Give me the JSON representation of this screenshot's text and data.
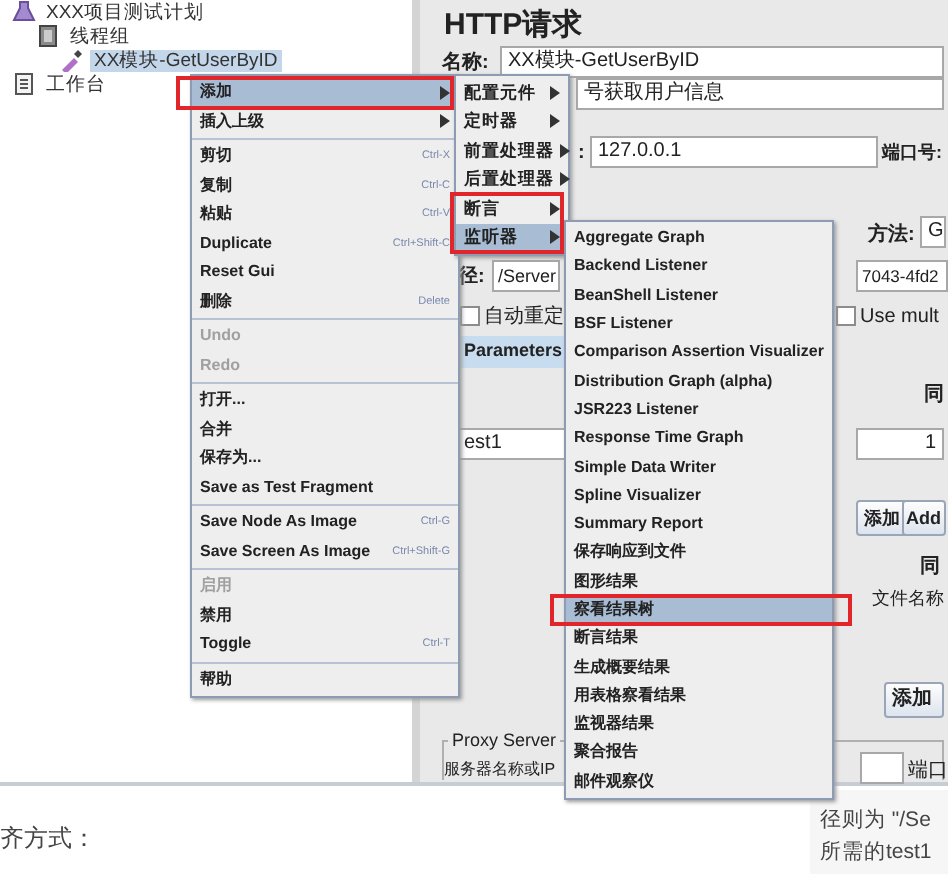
{
  "tree": [
    {
      "label": "XXX项目测试计划",
      "selected": false,
      "children": [
        {
          "label": "线程组",
          "selected": false,
          "children": [
            {
              "label": "XX模块-GetUserByID",
              "selected": true
            }
          ]
        }
      ]
    },
    {
      "label": "工作台",
      "selected": false
    }
  ],
  "http_panel": {
    "title": "HTTP请求",
    "name_label": "名称:",
    "name_value": "XX模块-GetUserByID",
    "comment_value": "号获取用户信息",
    "server_label": ":",
    "server_value": "127.0.0.1",
    "port_label": "端口号:",
    "method_label": "方法:",
    "method_value": "G",
    "path_label": "径:",
    "path_value": "/Server",
    "path_value_tail": "7043-4fd2",
    "redirect_label": "自动重定",
    "redirect_checked": false,
    "multipart_label": "Use mult",
    "multipart_checked": false,
    "tab": "Parameters",
    "header_1": "同",
    "cell_1": "est1",
    "cell_2": "1",
    "add_button": "添加",
    "add_button_2": "Add",
    "header_2": "同",
    "files_header": "文件名称",
    "add_button_3": "添加",
    "proxy_label": "Proxy Server",
    "proxy_host_label": "服务器名称或IP",
    "proxy_port_label": "端口"
  },
  "context_menu": [
    {
      "kind": "item",
      "label": "添加",
      "submenu": true,
      "selected": true,
      "annotated": true
    },
    {
      "kind": "item",
      "label": "插入上级",
      "submenu": true,
      "selected": false
    },
    {
      "kind": "separator"
    },
    {
      "kind": "item",
      "label": "剪切",
      "shortcut": "Ctrl-X",
      "selected": false
    },
    {
      "kind": "item",
      "label": "复制",
      "shortcut": "Ctrl-C",
      "selected": false
    },
    {
      "kind": "item",
      "label": "粘贴",
      "shortcut": "Ctrl-V",
      "selected": false
    },
    {
      "kind": "item",
      "label": "Duplicate",
      "shortcut": "Ctrl+Shift-C",
      "selected": false
    },
    {
      "kind": "item",
      "label": "Reset Gui",
      "selected": false
    },
    {
      "kind": "item",
      "label": "删除",
      "shortcut": "Delete",
      "selected": false
    },
    {
      "kind": "separator"
    },
    {
      "kind": "item",
      "label": "Undo",
      "disabled": true,
      "selected": false
    },
    {
      "kind": "item",
      "label": "Redo",
      "disabled": true,
      "selected": false
    },
    {
      "kind": "separator"
    },
    {
      "kind": "item",
      "label": "打开...",
      "selected": false
    },
    {
      "kind": "item",
      "label": "合并",
      "selected": false
    },
    {
      "kind": "item",
      "label": "保存为...",
      "selected": false
    },
    {
      "kind": "item",
      "label": "Save as Test Fragment",
      "selected": false
    },
    {
      "kind": "separator"
    },
    {
      "kind": "item",
      "label": "Save Node As Image",
      "shortcut": "Ctrl-G",
      "selected": false
    },
    {
      "kind": "item",
      "label": "Save Screen As Image",
      "shortcut": "Ctrl+Shift-G",
      "selected": false
    },
    {
      "kind": "separator"
    },
    {
      "kind": "item",
      "label": "启用",
      "disabled": true,
      "selected": false
    },
    {
      "kind": "item",
      "label": "禁用",
      "selected": false
    },
    {
      "kind": "item",
      "label": "Toggle",
      "shortcut": "Ctrl-T",
      "selected": false
    },
    {
      "kind": "separator"
    },
    {
      "kind": "item",
      "label": "帮助",
      "selected": false
    }
  ],
  "add_submenu": [
    {
      "kind": "item",
      "label": "配置元件",
      "submenu": true,
      "selected": false
    },
    {
      "kind": "item",
      "label": "定时器",
      "submenu": true,
      "selected": false
    },
    {
      "kind": "item",
      "label": "前置处理器",
      "submenu": true,
      "selected": false
    },
    {
      "kind": "item",
      "label": "后置处理器",
      "submenu": true,
      "selected": false
    },
    {
      "kind": "item",
      "label": "断言",
      "submenu": true,
      "selected": false,
      "annotated": true
    },
    {
      "kind": "item",
      "label": "监听器",
      "submenu": true,
      "selected": true,
      "annotated": true
    }
  ],
  "listener_submenu": [
    {
      "kind": "item",
      "label": "Aggregate Graph",
      "selected": false
    },
    {
      "kind": "item",
      "label": "Backend Listener",
      "selected": false
    },
    {
      "kind": "item",
      "label": "BeanShell Listener",
      "selected": false
    },
    {
      "kind": "item",
      "label": "BSF Listener",
      "selected": false
    },
    {
      "kind": "item",
      "label": "Comparison Assertion Visualizer",
      "selected": false
    },
    {
      "kind": "item",
      "label": "Distribution Graph (alpha)",
      "selected": false
    },
    {
      "kind": "item",
      "label": "JSR223 Listener",
      "selected": false
    },
    {
      "kind": "item",
      "label": "Response Time Graph",
      "selected": false
    },
    {
      "kind": "item",
      "label": "Simple Data Writer",
      "selected": false
    },
    {
      "kind": "item",
      "label": "Spline Visualizer",
      "selected": false
    },
    {
      "kind": "item",
      "label": "Summary Report",
      "selected": false
    },
    {
      "kind": "item",
      "label": "保存响应到文件",
      "selected": false
    },
    {
      "kind": "item",
      "label": "图形结果",
      "selected": false
    },
    {
      "kind": "item",
      "label": "察看结果树",
      "selected": true,
      "annotated": true
    },
    {
      "kind": "item",
      "label": "断言结果",
      "selected": false
    },
    {
      "kind": "item",
      "label": "生成概要结果",
      "selected": false
    },
    {
      "kind": "item",
      "label": "用表格察看结果",
      "selected": false
    },
    {
      "kind": "item",
      "label": "监视器结果",
      "selected": false
    },
    {
      "kind": "item",
      "label": "聚合报告",
      "selected": false
    },
    {
      "kind": "item",
      "label": "邮件观察仪",
      "selected": false
    }
  ],
  "article": {
    "left_text": "齐方式：",
    "right_lines": [
      "径则为 \"/Se",
      "所需的test1"
    ]
  }
}
